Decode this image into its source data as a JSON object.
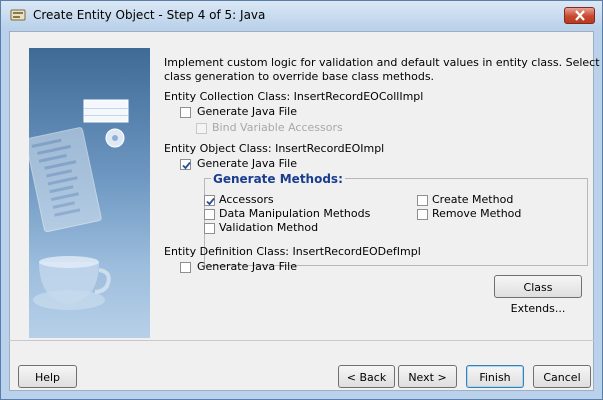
{
  "window": {
    "title": "Create Entity Object - Step 4 of 5: Java"
  },
  "description": {
    "line1": "Implement custom logic for validation and default values in entity class.  Select other",
    "line2": "class generation to override base class methods."
  },
  "collection": {
    "label": "Entity Collection Class: InsertRecordEOCollImpl",
    "generate_label": "Generate Java File",
    "generate_checked": false,
    "bind_label": "Bind Variable Accessors",
    "bind_checked": false
  },
  "object": {
    "label": "Entity Object Class: InsertRecordEOImpl",
    "generate_label": "Generate Java File",
    "generate_checked": true
  },
  "methods": {
    "title": "Generate Methods:",
    "accessors": "Accessors",
    "accessors_checked": true,
    "data_manipulation": "Data Manipulation Methods",
    "data_manipulation_checked": false,
    "validation": "Validation Method",
    "validation_checked": false,
    "create": "Create Method",
    "create_checked": false,
    "remove": "Remove Method",
    "remove_checked": false
  },
  "definition": {
    "label": "Entity Definition Class: InsertRecordEODefImpl",
    "generate_label": "Generate Java File",
    "generate_checked": false
  },
  "buttons": {
    "class_extends": "Class Extends...",
    "help": "Help",
    "back": "< Back",
    "next": "Next >",
    "finish": "Finish",
    "cancel": "Cancel"
  },
  "colors": {
    "accent_blue": "#1a3d8f",
    "close_red": "#c9482f",
    "check_blue": "#2a4f9a"
  }
}
